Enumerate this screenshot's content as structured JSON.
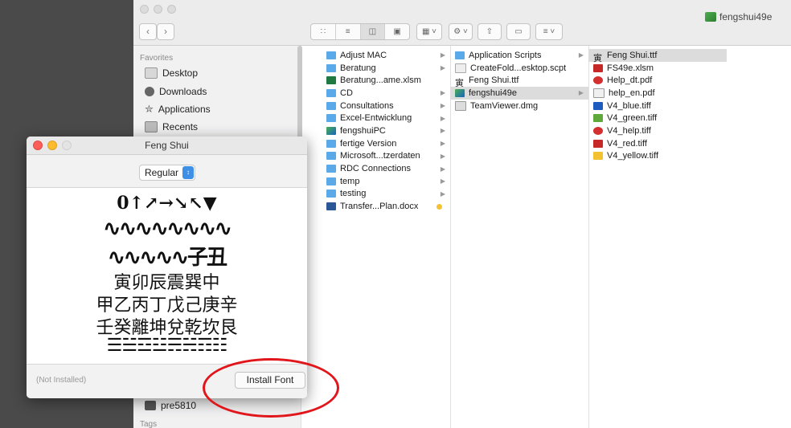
{
  "window": {
    "title": "fengshui49e"
  },
  "sidebar": {
    "favorites_heading": "Favorites",
    "items": [
      {
        "label": "Desktop",
        "icon": "desktop-icon"
      },
      {
        "label": "Downloads",
        "icon": "downloads-icon"
      },
      {
        "label": "Applications",
        "icon": "applications-icon"
      },
      {
        "label": "Recents",
        "icon": "recents-icon"
      }
    ],
    "device": "pre5810",
    "tags_heading": "Tags"
  },
  "column1": [
    {
      "label": "Adjust MAC",
      "kind": "folder",
      "arrow": true
    },
    {
      "label": "Beratung",
      "kind": "folder",
      "arrow": true
    },
    {
      "label": "Beratung...ame.xlsm",
      "kind": "excel",
      "arrow": false
    },
    {
      "label": "CD",
      "kind": "folder",
      "arrow": true
    },
    {
      "label": "Consultations",
      "kind": "folder",
      "arrow": true
    },
    {
      "label": "Excel-Entwicklung",
      "kind": "folder",
      "arrow": true
    },
    {
      "label": "fengshuiPC",
      "kind": "app",
      "arrow": true
    },
    {
      "label": "fertige Version",
      "kind": "folder",
      "arrow": true
    },
    {
      "label": "Microsoft...tzerdaten",
      "kind": "folder",
      "arrow": true
    },
    {
      "label": "RDC Connections",
      "kind": "folder",
      "arrow": true
    },
    {
      "label": "temp",
      "kind": "folder",
      "arrow": true
    },
    {
      "label": "testing",
      "kind": "folder",
      "arrow": true
    },
    {
      "label": "Transfer...Plan.docx",
      "kind": "word",
      "arrow": false
    }
  ],
  "column2": [
    {
      "label": "Application Scripts",
      "kind": "folder",
      "arrow": true
    },
    {
      "label": "CreateFold...esktop.scpt",
      "kind": "script",
      "arrow": false
    },
    {
      "label": "Feng Shui.ttf",
      "kind": "font",
      "arrow": false
    },
    {
      "label": "fengshui49e",
      "kind": "app",
      "arrow": true,
      "selected": true
    },
    {
      "label": "TeamViewer.dmg",
      "kind": "dmg",
      "arrow": false
    }
  ],
  "column3": [
    {
      "label": "Feng Shui.ttf",
      "kind": "font",
      "selected": true
    },
    {
      "label": "FS49e.xlsm",
      "kind": "excelred"
    },
    {
      "label": "Help_dt.pdf",
      "kind": "pdf"
    },
    {
      "label": "help_en.pdf",
      "kind": "pdfdoc"
    },
    {
      "label": "V4_blue.tiff",
      "kind": "tiffblue"
    },
    {
      "label": "V4_green.tiff",
      "kind": "tiffgreen"
    },
    {
      "label": "V4_help.tiff",
      "kind": "tiffhelp"
    },
    {
      "label": "V4_red.tiff",
      "kind": "tiffred"
    },
    {
      "label": "V4_yellow.tiff",
      "kind": "tiffyellow"
    }
  ],
  "font_dialog": {
    "title": "Feng Shui",
    "style_value": "Regular",
    "status": "(Not Installed)",
    "install_label": "Install Font",
    "preview_lines": [
      "0↑↗→↘↖▼",
      "∿∿∿∿∿∿∿∿",
      "∿∿∿∿∿子丑",
      "寅卯辰震巽中",
      "甲乙丙丁戊己庚辛",
      "壬癸離坤兌乾坎艮",
      "☰☱☲☳☴☵☶☷"
    ]
  },
  "colors": {
    "folder": "#5aa9e8",
    "highlight": "#e0161b",
    "accent": "#3e8fe8"
  }
}
